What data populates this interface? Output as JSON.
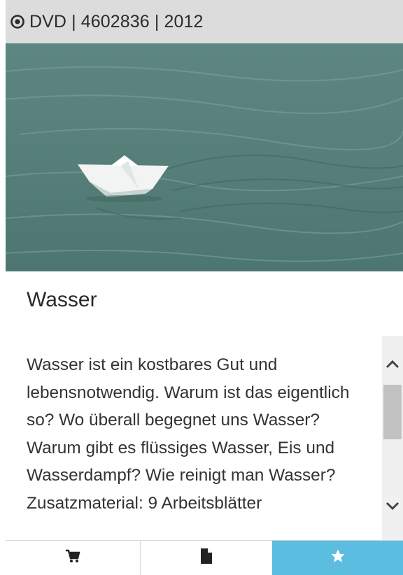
{
  "header": {
    "meta_icon": "dot-circle-icon",
    "meta_text": "DVD | 4602836 | 2012"
  },
  "item": {
    "title": "Wasser",
    "description": "Wasser ist ein kostbares Gut und lebensnotwendig. Warum ist das eigentlich so? Wo überall begegnet uns Wasser? Warum gibt es flüssiges Wasser, Eis und Wasserdampf? Wie reinigt man Wasser? Zusatzmaterial: 9 Arbeitsblätter"
  },
  "toolbar": {
    "cart_icon": "cart-icon",
    "document_icon": "document-icon",
    "favorite_icon": "star-icon",
    "favorite_color": "#5bbde0"
  }
}
